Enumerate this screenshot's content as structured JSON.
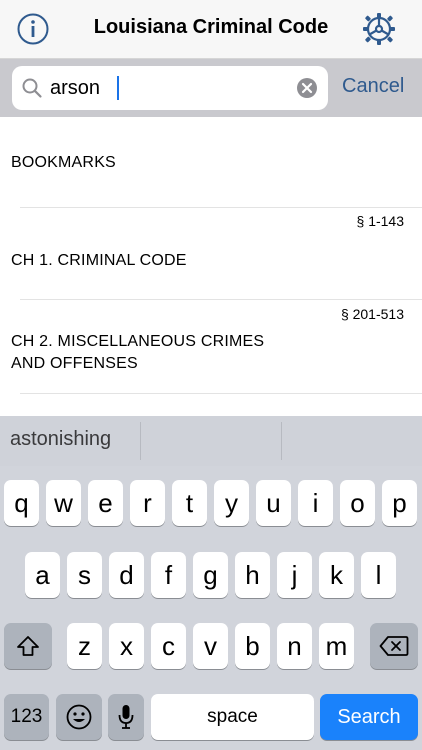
{
  "nav": {
    "title": "Louisiana Criminal Code"
  },
  "search": {
    "value": "arson",
    "cancel_label": "Cancel"
  },
  "list": {
    "rows": [
      {
        "label_lines": [
          "BOOKMARKS"
        ],
        "range": ""
      },
      {
        "label_lines": [
          "CH 1. CRIMINAL CODE"
        ],
        "range": "§ 1-143"
      },
      {
        "label_lines": [
          "CH 2. MISCELLANEOUS CRIMES",
          "AND OFFENSES"
        ],
        "range": "§ 201-513"
      }
    ]
  },
  "keyboard": {
    "prediction": "astonishing",
    "row1": [
      "q",
      "w",
      "e",
      "r",
      "t",
      "y",
      "u",
      "i",
      "o",
      "p"
    ],
    "row2": [
      "a",
      "s",
      "d",
      "f",
      "g",
      "h",
      "j",
      "k",
      "l"
    ],
    "row3": [
      "z",
      "x",
      "c",
      "v",
      "b",
      "n",
      "m"
    ],
    "numbers_label": "123",
    "space_label": "space",
    "search_label": "Search"
  },
  "colors": {
    "accent": "#2f5a8e",
    "search_key": "#1a82fb",
    "keyboard_bg": "#d1d4db"
  },
  "icons": [
    "info-icon",
    "settings-wheel-icon",
    "search-icon",
    "clear-icon",
    "shift-icon",
    "delete-icon",
    "emoji-icon",
    "microphone-icon"
  ]
}
